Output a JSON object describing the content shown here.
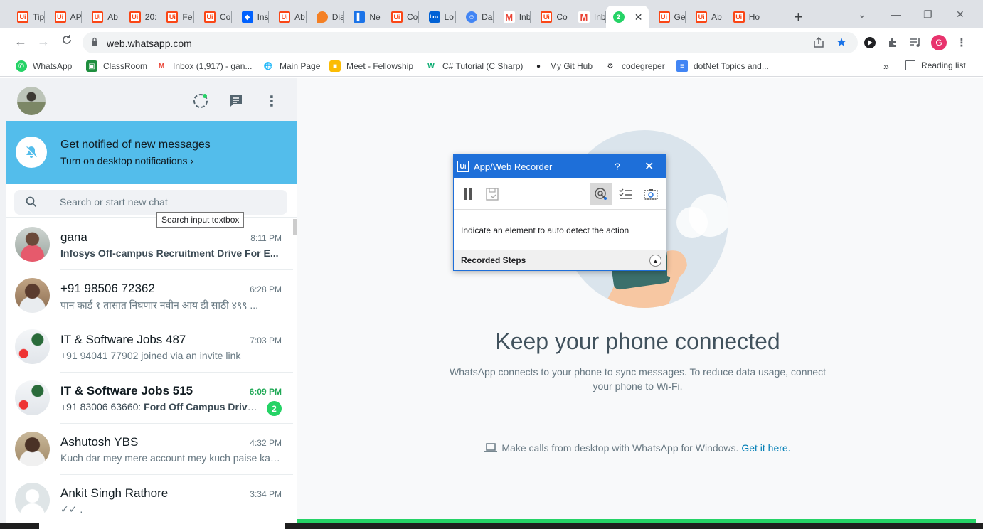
{
  "browser": {
    "tabs": [
      {
        "icon": "uipath",
        "label": "Tip"
      },
      {
        "icon": "uipath",
        "label": "AP"
      },
      {
        "icon": "uipath",
        "label": "Ab"
      },
      {
        "icon": "uipath",
        "label": "20:"
      },
      {
        "icon": "uipath",
        "label": "Fel"
      },
      {
        "icon": "uipath",
        "label": "Co"
      },
      {
        "icon": "dropbox",
        "label": "Ins"
      },
      {
        "icon": "uipath",
        "label": "Ab"
      },
      {
        "icon": "dia",
        "label": "Dia"
      },
      {
        "icon": "notion",
        "label": "Ne"
      },
      {
        "icon": "uipath",
        "label": "Co"
      },
      {
        "icon": "box",
        "label": "Lo"
      },
      {
        "icon": "discord",
        "label": "Da"
      },
      {
        "icon": "gmail",
        "label": "Inb"
      },
      {
        "icon": "uipath",
        "label": "Co"
      },
      {
        "icon": "gmail",
        "label": "Inb"
      },
      {
        "icon": "whatsapp",
        "label": "2",
        "active": true
      },
      {
        "icon": "uipath",
        "label": "Ge"
      },
      {
        "icon": "uipath",
        "label": "Ab"
      },
      {
        "icon": "uipath",
        "label": "Ho"
      }
    ],
    "new_tab": "+",
    "url": "web.whatsapp.com",
    "profile_initial": "G",
    "bookmarks": [
      {
        "icon": "whatsapp",
        "label": "WhatsApp"
      },
      {
        "icon": "classroom",
        "label": "ClassRoom"
      },
      {
        "icon": "gmail",
        "label": "Inbox (1,917) - gan..."
      },
      {
        "icon": "wikipedia",
        "label": "Main Page"
      },
      {
        "icon": "meet",
        "label": "Meet - Fellowship"
      },
      {
        "icon": "w3schools",
        "label": "C# Tutorial (C Sharp)"
      },
      {
        "icon": "github",
        "label": "My Git Hub"
      },
      {
        "icon": "codegrepper",
        "label": "codegreper"
      },
      {
        "icon": "doc",
        "label": "dotNet Topics and..."
      }
    ],
    "bookmarks_more": "»",
    "reading_list": "Reading list"
  },
  "notification": {
    "title": "Get notified of new messages",
    "subtitle": "Turn on desktop notifications ›"
  },
  "search": {
    "placeholder": "Search or start new chat",
    "tooltip": "Search input textbox"
  },
  "chats": [
    {
      "name": "gana",
      "time": "8:11 PM",
      "message": "Infosys Off-campus Recruitment Drive For E...",
      "bold_msg": true
    },
    {
      "name": "+91 98506 72362",
      "time": "6:28 PM",
      "message": "पान कार्ड १ तासात निघणार  नवीन आय डी साठी ४९९ ..."
    },
    {
      "name": "IT & Software Jobs 487",
      "time": "7:03 PM",
      "message": "+91 94041 77902 joined via an invite link"
    },
    {
      "name": "IT & Software Jobs 515",
      "time": "6:09 PM",
      "message_prefix": "+91 83006 63660: ",
      "message": "Ford Off Campus Drive ...",
      "unread": "2",
      "bold": true
    },
    {
      "name": "Ashutosh YBS",
      "time": "4:32 PM",
      "message": "Kuch dar mey mere account mey kuch paise ka ..."
    },
    {
      "name": "Ankit Singh Rathore",
      "time": "3:34 PM",
      "message": "✓✓ ."
    }
  ],
  "intro": {
    "headline": "Keep your phone connected",
    "subtext": "WhatsApp connects to your phone to sync messages. To reduce data usage, connect your phone to Wi-Fi.",
    "calls_text": "Make calls from desktop with WhatsApp for Windows. ",
    "calls_link": "Get it here."
  },
  "recorder": {
    "title": "App/Web Recorder",
    "help": "?",
    "close": "✕",
    "message": "Indicate an element to auto detect the action",
    "steps_label": "Recorded Steps"
  },
  "colors": {
    "whatsapp_green": "#25d366",
    "notif_blue": "#53bdeb",
    "uipath_blue": "#1e6fd9"
  }
}
